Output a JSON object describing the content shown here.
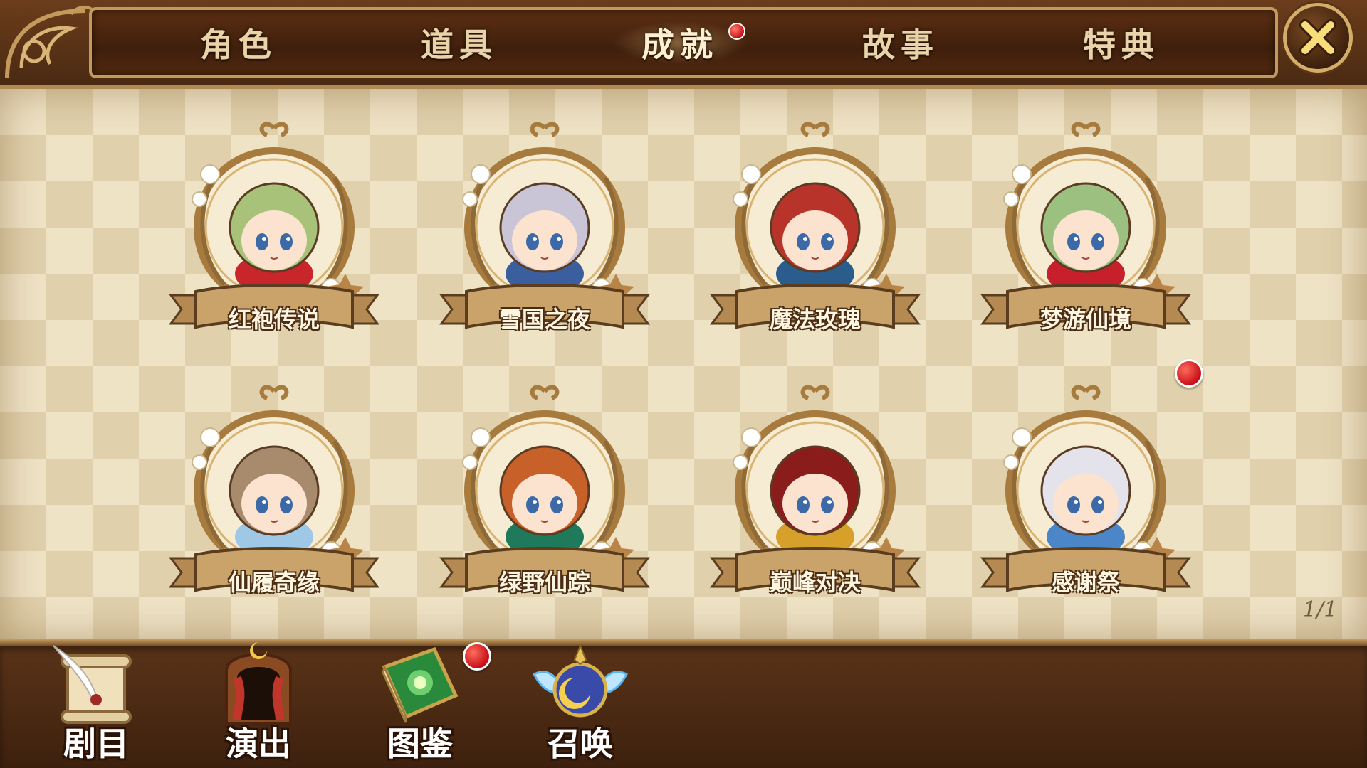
{
  "tabs": [
    {
      "label": "角色",
      "active": false,
      "badge": false
    },
    {
      "label": "道具",
      "active": false,
      "badge": false
    },
    {
      "label": "成就",
      "active": true,
      "badge": true
    },
    {
      "label": "故事",
      "active": false,
      "badge": false
    },
    {
      "label": "特典",
      "active": false,
      "badge": false
    }
  ],
  "close_icon": "close-icon",
  "achievements": [
    {
      "label": "红袍传说",
      "hair": "#a8c27a",
      "accent": "#c8262b",
      "badge": false
    },
    {
      "label": "雪国之夜",
      "hair": "#c9c4d6",
      "accent": "#3b5f9e",
      "badge": false
    },
    {
      "label": "魔法玫瑰",
      "hair": "#b8342a",
      "accent": "#2a5d8c",
      "badge": false
    },
    {
      "label": "梦游仙境",
      "hair": "#9cc080",
      "accent": "#c81f2d",
      "badge": false
    },
    {
      "label": "仙履奇缘",
      "hair": "#a88a6c",
      "accent": "#9fc7e6",
      "badge": false
    },
    {
      "label": "绿野仙踪",
      "hair": "#c8602a",
      "accent": "#1f7a5c",
      "badge": false
    },
    {
      "label": "巅峰对决",
      "hair": "#8a1c1c",
      "accent": "#d6a02a",
      "badge": false
    },
    {
      "label": "感谢祭",
      "hair": "#e4e2ea",
      "accent": "#4a86c8",
      "badge": true
    }
  ],
  "page_indicator": "1/1",
  "bottom_nav": [
    {
      "label": "剧目",
      "icon": "scroll-quill-icon",
      "badge": false
    },
    {
      "label": "演出",
      "icon": "stage-theater-icon",
      "badge": false
    },
    {
      "label": "图鉴",
      "icon": "green-book-icon",
      "badge": true
    },
    {
      "label": "召唤",
      "icon": "winged-moon-orb-icon",
      "badge": false
    }
  ],
  "colors": {
    "badge_red": "#c8121b",
    "wood_dark": "#3d210e",
    "parchment": "#efe3c6",
    "frame_gold": "#c49a5c"
  }
}
